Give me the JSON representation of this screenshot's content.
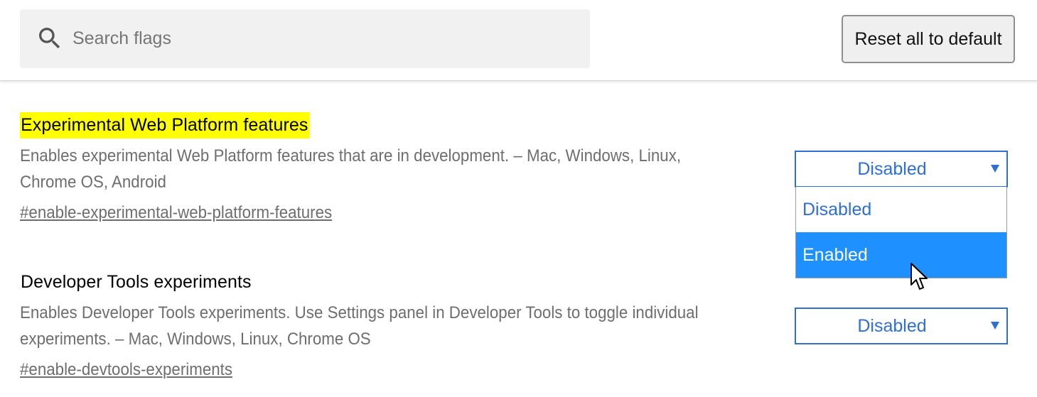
{
  "header": {
    "search": {
      "placeholder": "Search flags",
      "value": ""
    },
    "reset_button_label": "Reset all to default"
  },
  "flags": [
    {
      "title": "Experimental Web Platform features",
      "highlighted": true,
      "description": "Enables experimental Web Platform features that are in development. – Mac, Windows, Linux, Chrome OS, Android",
      "link": "#enable-experimental-web-platform-features",
      "select_value": "Disabled",
      "dropdown_open": true,
      "options": [
        "Disabled",
        "Enabled"
      ],
      "hovered_option": "Enabled"
    },
    {
      "title": "Developer Tools experiments",
      "highlighted": false,
      "description": "Enables Developer Tools experiments. Use Settings panel in Developer Tools to toggle individual experiments. – Mac, Windows, Linux, Chrome OS",
      "link": "#enable-devtools-experiments",
      "select_value": "Disabled",
      "dropdown_open": false
    }
  ],
  "icons": {
    "search": "search-icon",
    "dropdown_arrow": "dropdown-arrow-icon",
    "cursor": "mouse-pointer-icon"
  },
  "colors": {
    "highlight": "#ffff00",
    "select_accent": "#2f6fd4",
    "option_hover": "#1e90ff",
    "description_text": "#6e6e6e"
  }
}
